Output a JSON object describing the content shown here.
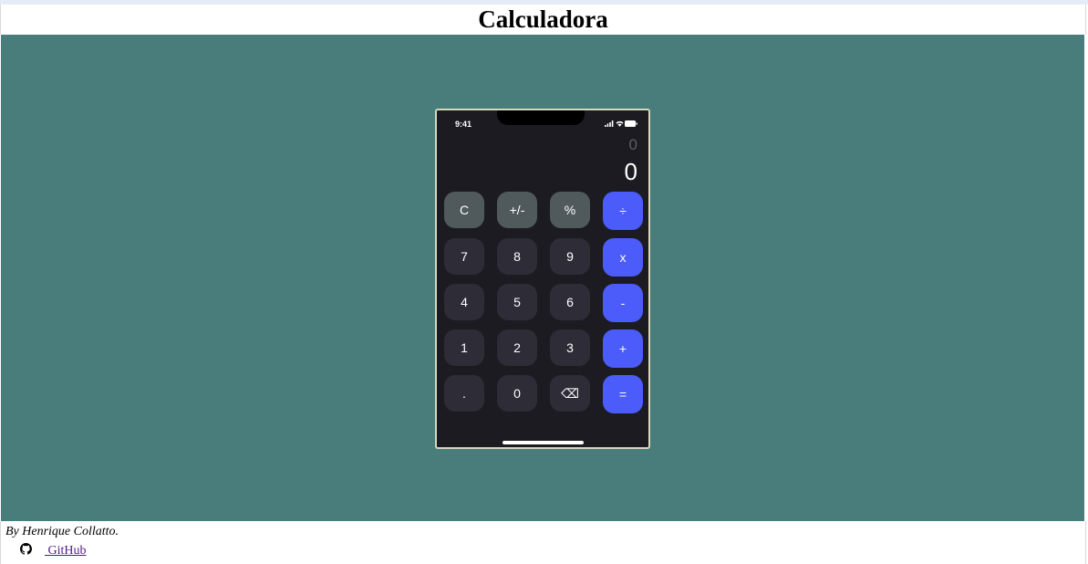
{
  "page": {
    "title": "Calculadora"
  },
  "phone": {
    "status_time": "9:41",
    "display": {
      "previous": "0",
      "current": "0"
    },
    "keys": [
      {
        "label": "C",
        "kind": "fn",
        "name": "clear"
      },
      {
        "label": "+/-",
        "kind": "fn",
        "name": "sign-toggle"
      },
      {
        "label": "%",
        "kind": "fn",
        "name": "percent"
      },
      {
        "label": "÷",
        "kind": "op",
        "name": "divide"
      },
      {
        "label": "7",
        "kind": "num",
        "name": "digit-7"
      },
      {
        "label": "8",
        "kind": "num",
        "name": "digit-8"
      },
      {
        "label": "9",
        "kind": "num",
        "name": "digit-9"
      },
      {
        "label": "x",
        "kind": "op",
        "name": "multiply"
      },
      {
        "label": "4",
        "kind": "num",
        "name": "digit-4"
      },
      {
        "label": "5",
        "kind": "num",
        "name": "digit-5"
      },
      {
        "label": "6",
        "kind": "num",
        "name": "digit-6"
      },
      {
        "label": "-",
        "kind": "op",
        "name": "subtract"
      },
      {
        "label": "1",
        "kind": "num",
        "name": "digit-1"
      },
      {
        "label": "2",
        "kind": "num",
        "name": "digit-2"
      },
      {
        "label": "3",
        "kind": "num",
        "name": "digit-3"
      },
      {
        "label": "+",
        "kind": "op",
        "name": "add"
      },
      {
        "label": ".",
        "kind": "num",
        "name": "decimal"
      },
      {
        "label": "0",
        "kind": "num",
        "name": "digit-0"
      },
      {
        "label": "⌫",
        "kind": "num",
        "name": "backspace"
      },
      {
        "label": "=",
        "kind": "op",
        "name": "equals"
      }
    ]
  },
  "footer": {
    "byline": "By Henrique Collatto.",
    "github_label": " GitHub",
    "github_icon": "github-icon"
  },
  "colors": {
    "background": "#487d7b",
    "phone_body": "#1c1b21",
    "function_key": "#505a5c",
    "number_key": "#2d2c37",
    "operator_key": "#4b5cfa"
  }
}
